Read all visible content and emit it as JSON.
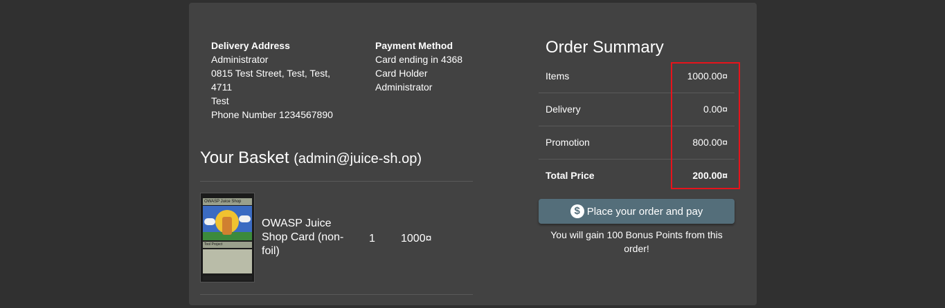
{
  "delivery": {
    "heading": "Delivery Address",
    "name": "Administrator",
    "street": "0815 Test Street, Test, Test, 4711",
    "city": "Test",
    "phone": "Phone Number 1234567890"
  },
  "payment": {
    "heading": "Payment Method",
    "card": "Card ending in 4368",
    "holder_label": "Card Holder",
    "holder": "Administrator"
  },
  "basket": {
    "title": "Your Basket",
    "email": "(admin@juice-sh.op)",
    "items": [
      {
        "name": "OWASP Juice Shop Card (non-foil)",
        "quantity": "1",
        "price": "1000¤",
        "image_banner": "OWASP Juice Shop",
        "image_type": "Tool Project"
      }
    ]
  },
  "summary": {
    "title": "Order Summary",
    "rows": [
      {
        "label": "Items",
        "value": "1000.00¤"
      },
      {
        "label": "Delivery",
        "value": "0.00¤"
      },
      {
        "label": "Promotion",
        "value": "800.00¤"
      },
      {
        "label": "Total Price",
        "value": "200.00¤"
      }
    ],
    "highlight_color": "#e8131b"
  },
  "order_button": {
    "icon": "dollar-icon",
    "label": "Place your order and pay"
  },
  "bonus_text": "You will gain 100 Bonus Points from this order!",
  "colors": {
    "background": "#303030",
    "card": "#424242",
    "button": "#546e7a"
  }
}
